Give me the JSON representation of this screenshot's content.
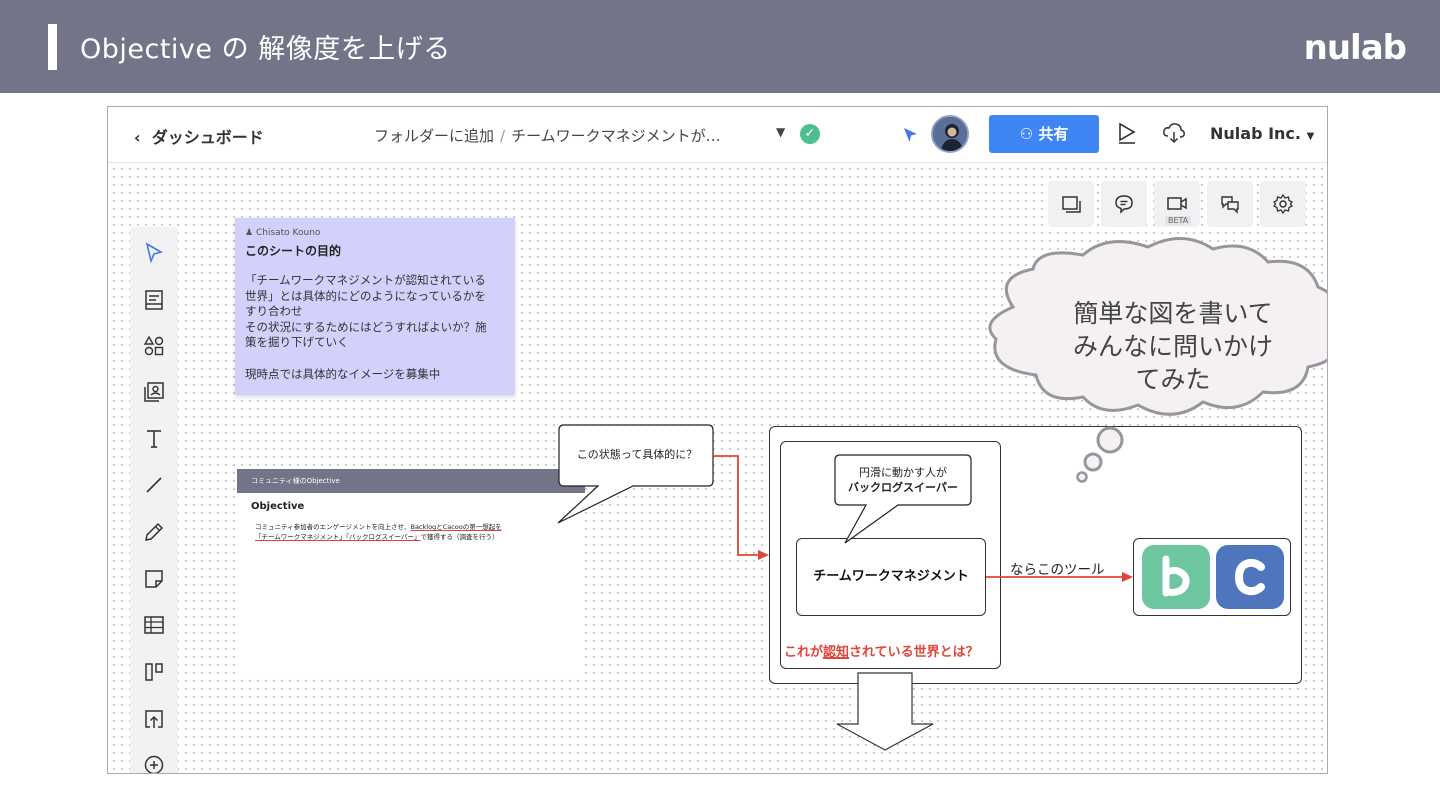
{
  "slide": {
    "title": "Objective の 解像度を上げる",
    "brand": "nulab"
  },
  "app": {
    "back_label": "ダッシュボード",
    "folder_label": "フォルダーに追加",
    "breadcrumb_sep": "/",
    "doc_title": "チームワークマネジメントが…",
    "share_label": "共有",
    "org_label": "Nulab Inc.",
    "beta_label": "BETA"
  },
  "icons": {
    "right_tools": [
      "layers-icon",
      "comment-icon",
      "video-icon",
      "chat-icon",
      "settings-icon"
    ],
    "left_tools": [
      "select-icon",
      "template-icon",
      "shapes-icon",
      "image-icon",
      "text-icon",
      "line-icon",
      "pen-icon",
      "sticky-note-icon",
      "table-icon",
      "kanban-icon",
      "upload-icon",
      "more-icon"
    ]
  },
  "sticky": {
    "author": "Chisato Kouno",
    "heading": "このシートの目的",
    "lines": [
      "「チームワークマネジメントが認知されている",
      "世界」とは具体的にどのようになっているかを",
      "すり合わせ",
      "その状況にするためにはどうすればよいか？施",
      "策を掘り下げていく"
    ],
    "footer": "現時点では具体的なイメージを募集中"
  },
  "objective_card": {
    "header": "コミュニティ様のObjective",
    "title": "Objective",
    "line1_a": "コミュニティ参加者のエンゲージメントを向上させ、",
    "line1_b": "BacklogとCacooの第一想起を",
    "line2_a": "「チームワークマネジメント」「バックログスイーパー」",
    "line2_b": "で獲得する（調査を行う）"
  },
  "diagram": {
    "callout_question": "この状態って具体的に？",
    "callout_people_1": "円滑に動かす人が",
    "callout_people_2": "バックログスイーパー",
    "center_box": "チームワークマネジメント",
    "arrow_label": "ならこのツール",
    "recognition_prefix": "これが",
    "recognition_em": "認知",
    "recognition_suffix": "されている世界とは？"
  },
  "thought_bubble": {
    "line1": "簡単な図を書いて",
    "line2": "みんなに問いかけ",
    "line3": "てみた"
  },
  "colors": {
    "header_bg": "#747489",
    "share_blue": "#3f86f4",
    "sticky_purple": "#d2d1fb",
    "accent_red": "#e0453a",
    "backlog_green": "#6dc6a0",
    "cacoo_blue": "#4f76bd",
    "status_green": "#4dbf8d"
  }
}
